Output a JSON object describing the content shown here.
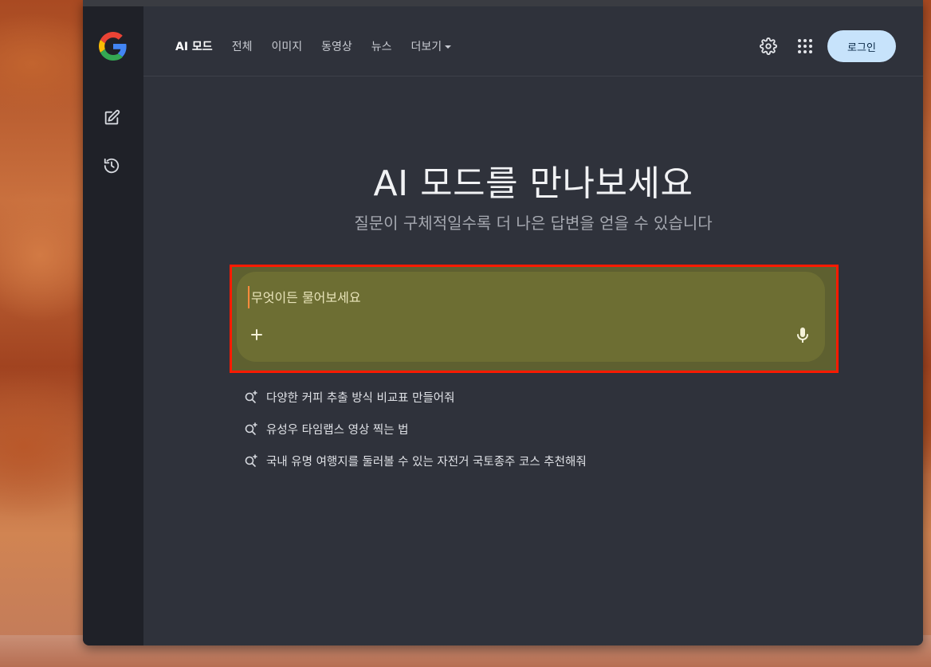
{
  "nav": {
    "items": [
      {
        "label": "AI 모드",
        "active": true
      },
      {
        "label": "전체"
      },
      {
        "label": "이미지"
      },
      {
        "label": "동영상"
      },
      {
        "label": "뉴스"
      }
    ],
    "more_label": "더보기"
  },
  "header": {
    "login_label": "로그인",
    "icons": [
      "settings-icon",
      "apps-grid-icon"
    ]
  },
  "sidebar": {
    "icons": [
      "google-logo",
      "new-chat-icon",
      "history-icon"
    ]
  },
  "hero": {
    "title": "AI 모드를 만나보세요",
    "subtitle": "질문이 구체적일수록 더 나은 답변을 얻을 수 있습니다"
  },
  "search": {
    "placeholder": "무엇이든 물어보세요",
    "add_icon": "plus-icon",
    "mic_icon": "mic-icon"
  },
  "suggestions": [
    "다양한 커피 추출 방식 비교표 만들어줘",
    "유성우 타임랩스 영상 찍는 법",
    "국내 유명 여행지를 둘러볼 수 있는 자전거 국토종주 코스 추천해줘"
  ],
  "colors": {
    "highlight_border": "#ff1a00",
    "login_bg": "#c7e3fb",
    "window_bg": "#2f323b"
  }
}
